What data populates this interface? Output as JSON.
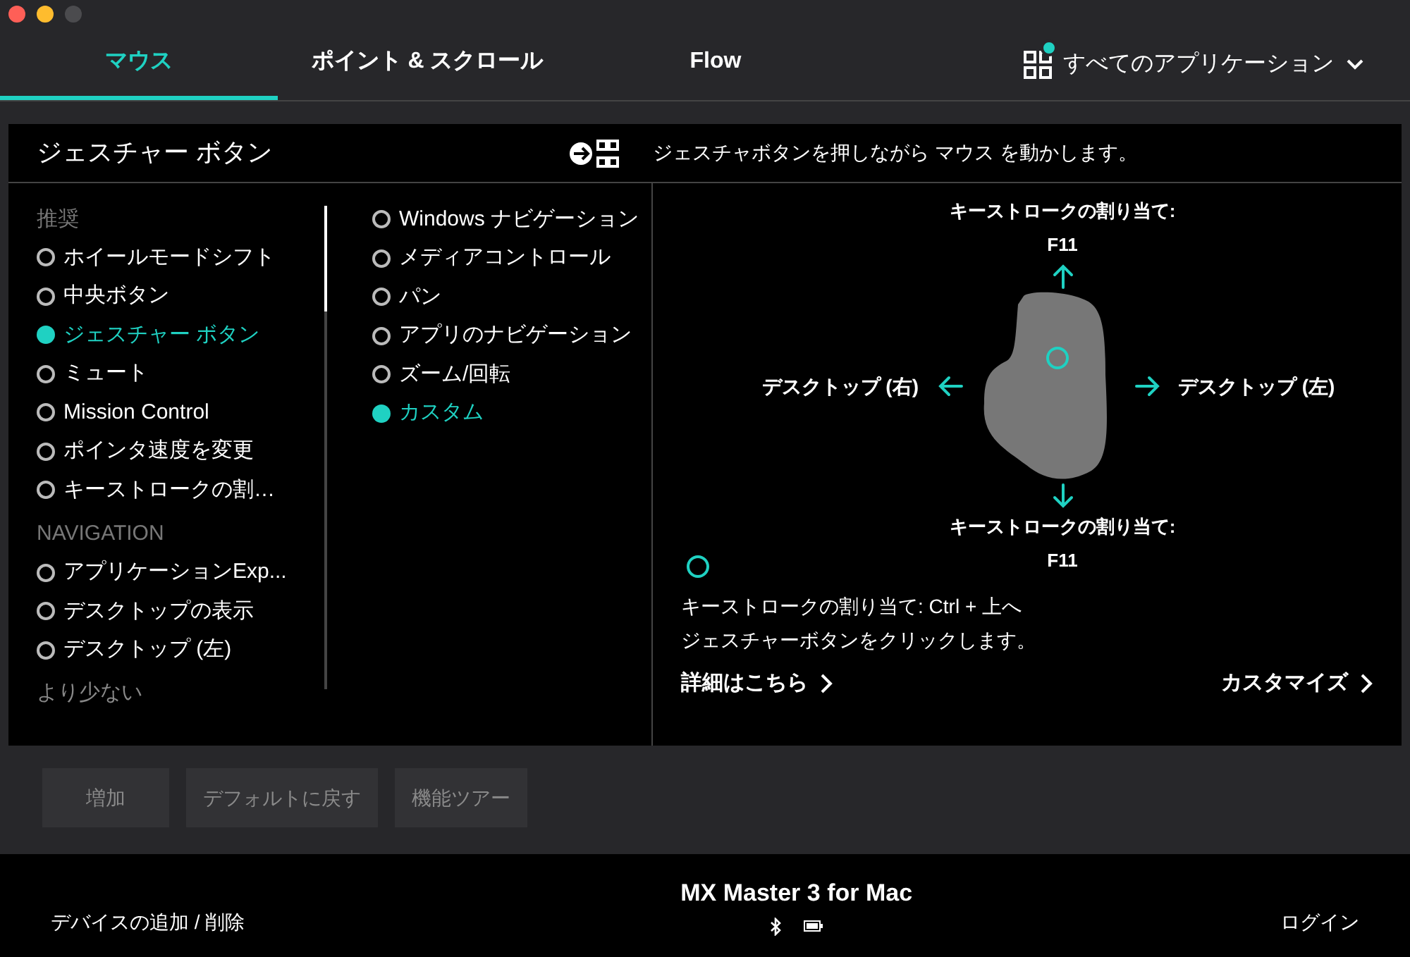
{
  "tabs": [
    {
      "label": "マウス",
      "selected": true
    },
    {
      "label": "ポイント & スクロール",
      "selected": false
    },
    {
      "label": "Flow",
      "selected": false
    }
  ],
  "app_selector": {
    "label": "すべてのアプリケーション",
    "badge": true
  },
  "panel": {
    "title": "ジェスチャー ボタン",
    "hint": "ジェスチャボタンを押しながら マウス を動かします。"
  },
  "action_groups": [
    {
      "heading": "推奨",
      "items": [
        {
          "label": "ホイールモードシフト",
          "selected": false
        },
        {
          "label": "中央ボタン",
          "selected": false
        },
        {
          "label": "ジェスチャー ボタン",
          "selected": true
        },
        {
          "label": "ミュート",
          "selected": false
        },
        {
          "label": "Mission Control",
          "selected": false
        },
        {
          "label": "ポインタ速度を変更",
          "selected": false
        },
        {
          "label": "キーストロークの割…",
          "selected": false
        }
      ]
    },
    {
      "heading": "NAVIGATION",
      "items": [
        {
          "label": "アプリケーションExp...",
          "selected": false
        },
        {
          "label": "デスクトップの表示",
          "selected": false
        },
        {
          "label": "デスクトップ (左)",
          "selected": false
        }
      ]
    }
  ],
  "less_link": "より少ない",
  "gesture_modes": [
    {
      "label": "Windows ナビゲーション",
      "selected": false
    },
    {
      "label": "メディアコントロール",
      "selected": false
    },
    {
      "label": "パン",
      "selected": false
    },
    {
      "label": "アプリのナビゲーション",
      "selected": false
    },
    {
      "label": "ズーム/回転",
      "selected": false
    },
    {
      "label": "カスタム",
      "selected": true
    }
  ],
  "gestures": {
    "up": [
      "キーストロークの割り当て:",
      "F11"
    ],
    "down": [
      "キーストロークの割り当て:",
      "F11"
    ],
    "left": "デスクトップ (右)",
    "right": "デスクトップ (左)"
  },
  "click_action": [
    "キーストロークの割り当て: Ctrl + 上へ",
    "ジェスチャーボタンをクリックします。"
  ],
  "learn_more": "詳細はこちら",
  "customize": "カスタマイズ",
  "buttons": [
    "増加",
    "デフォルトに戻す",
    "機能ツアー"
  ],
  "footer": {
    "add_remove": "デバイスの追加 / 削除",
    "device": "MX Master 3 for Mac",
    "login": "ログイン"
  }
}
